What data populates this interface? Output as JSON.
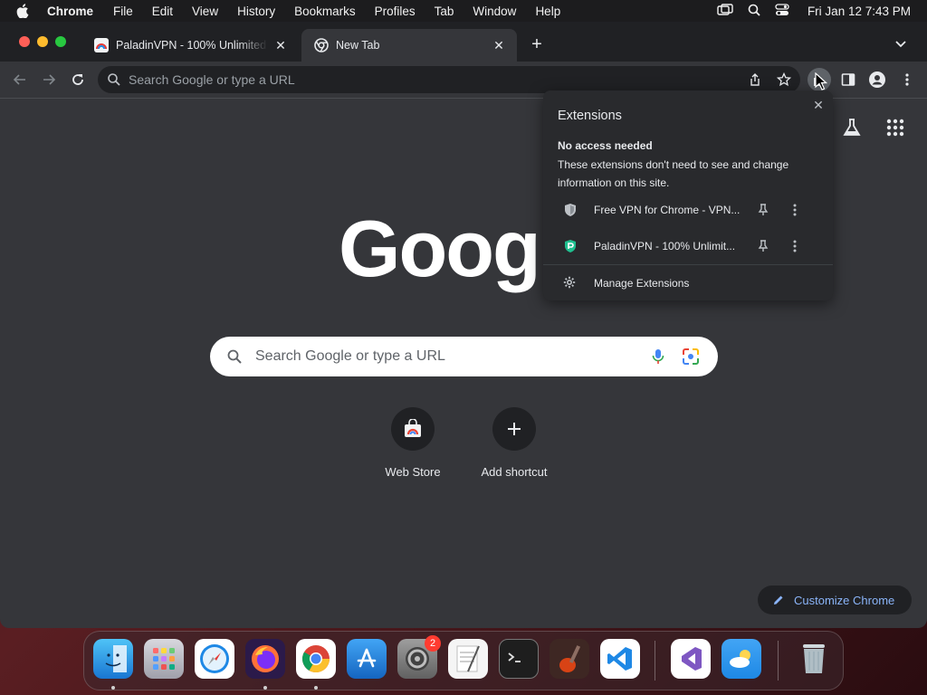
{
  "menubar": {
    "app_name": "Chrome",
    "items": [
      "File",
      "Edit",
      "View",
      "History",
      "Bookmarks",
      "Profiles",
      "Tab",
      "Window",
      "Help"
    ],
    "clock": "Fri Jan 12  7:43 PM"
  },
  "tabs": [
    {
      "title": "PaladinVPN - 100% Unlimited Free VPN",
      "favicon": "paladin-favicon"
    },
    {
      "title": "New Tab",
      "favicon": "chrome-favicon",
      "active": true
    }
  ],
  "toolbar": {
    "omnibox_placeholder": "Search Google or type a URL"
  },
  "ntp": {
    "logo_text": "Google",
    "search_placeholder": "Search Google or type a URL",
    "shortcuts": [
      {
        "label": "Web Store",
        "icon": "web-store-icon"
      },
      {
        "label": "Add shortcut",
        "icon": "plus-icon"
      }
    ],
    "customize_label": "Customize Chrome"
  },
  "extensions_popup": {
    "title": "Extensions",
    "section_title": "No access needed",
    "section_text": "These extensions don't need to see and change information on this site.",
    "items": [
      {
        "name": "Free VPN for Chrome - VPN...",
        "icon": "shield-icon"
      },
      {
        "name": "PaladinVPN - 100% Unlimit...",
        "icon": "paladin-icon"
      }
    ],
    "manage_label": "Manage Extensions"
  },
  "dock": {
    "apps": [
      "Finder",
      "Launchpad",
      "Safari",
      "Firefox",
      "Google Chrome",
      "App Store",
      "System Settings",
      "TextEdit",
      "Terminal",
      "Instruments",
      "Visual Studio Code",
      "Visual Studio",
      "Weather",
      "Trash"
    ],
    "system_settings_badge": "2"
  },
  "colors": {
    "window_bg": "#35363a",
    "tabstrip_bg": "#202124",
    "popup_bg": "#292a2d",
    "link_blue": "#8ab4f8"
  }
}
